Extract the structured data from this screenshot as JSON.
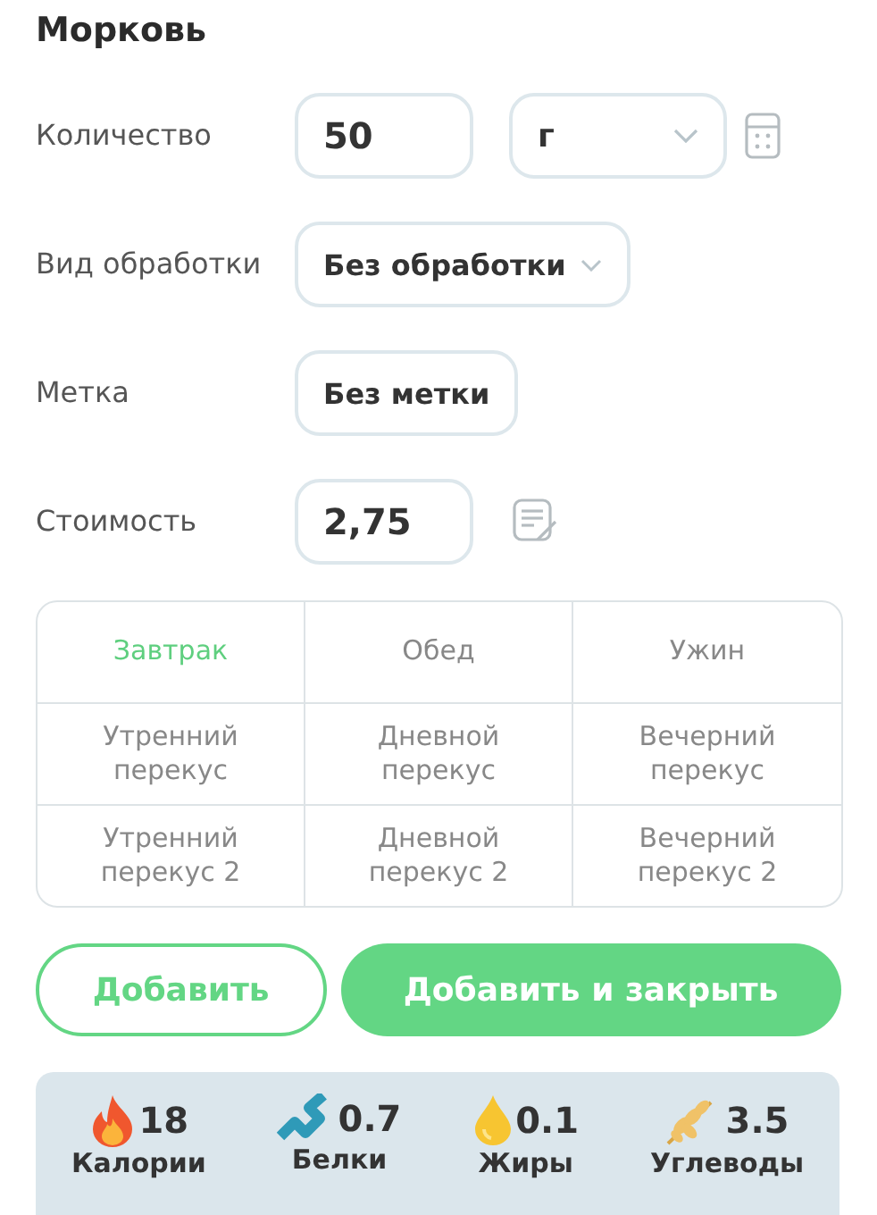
{
  "title": "Морковь",
  "quantity": {
    "label": "Количество",
    "value": "50",
    "unit": "г"
  },
  "processing": {
    "label": "Вид обработки",
    "value": "Без обработки"
  },
  "tag": {
    "label": "Метка",
    "value": "Без метки"
  },
  "cost": {
    "label": "Стоимость",
    "value": "2,75"
  },
  "meals": [
    {
      "label": "Завтрак",
      "selected": true
    },
    {
      "label": "Обед",
      "selected": false
    },
    {
      "label": "Ужин",
      "selected": false
    },
    {
      "label": "Утренний перекус",
      "selected": false
    },
    {
      "label": "Дневной перекус",
      "selected": false
    },
    {
      "label": "Вечерний перекус",
      "selected": false
    },
    {
      "label": "Утренний перекус 2",
      "selected": false
    },
    {
      "label": "Дневной перекус 2",
      "selected": false
    },
    {
      "label": "Вечерний перекус 2",
      "selected": false
    }
  ],
  "buttons": {
    "add": "Добавить",
    "add_close": "Добавить и закрыть"
  },
  "nutrients": [
    {
      "kind": "calories",
      "value": "18",
      "label": "Калории"
    },
    {
      "kind": "protein",
      "value": "0.7",
      "label": "Белки"
    },
    {
      "kind": "fat",
      "value": "0.1",
      "label": "Жиры"
    },
    {
      "kind": "carbs",
      "value": "3.5",
      "label": "Углеводы"
    }
  ]
}
